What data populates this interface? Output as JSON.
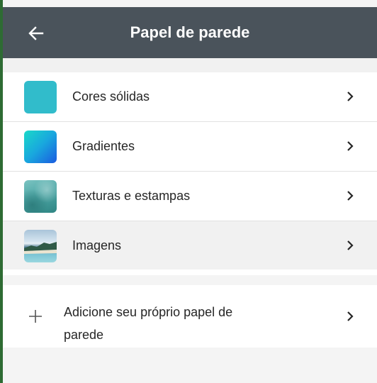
{
  "header": {
    "title": "Papel de parede",
    "back_icon": "arrow-left-icon",
    "background": "#4a535b"
  },
  "categories": [
    {
      "label": "Cores sólidas",
      "thumb": "solid",
      "color": "#31bccb"
    },
    {
      "label": "Gradientes",
      "thumb": "gradient"
    },
    {
      "label": "Texturas e estampas",
      "thumb": "texture"
    },
    {
      "label": "Imagens",
      "thumb": "image"
    }
  ],
  "add_wallpaper": {
    "line1": "Adicione seu próprio papel de",
    "line2": "parede",
    "icon": "plus-icon"
  },
  "chevron_icon": "chevron-right-icon"
}
